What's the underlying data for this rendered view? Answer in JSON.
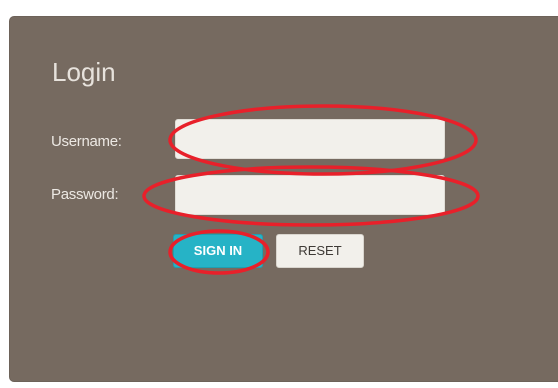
{
  "login": {
    "title": "Login",
    "username_label": "Username:",
    "password_label": "Password:",
    "username_value": "",
    "password_value": "",
    "signin_label": "SIGN IN",
    "reset_label": "RESET"
  },
  "colors": {
    "panel_background": "#766a60",
    "field_background": "#f2f0eb",
    "signin_button": "#26b3c6",
    "reset_button": "#f2f0eb",
    "annotation_highlight": "#e8202a"
  }
}
